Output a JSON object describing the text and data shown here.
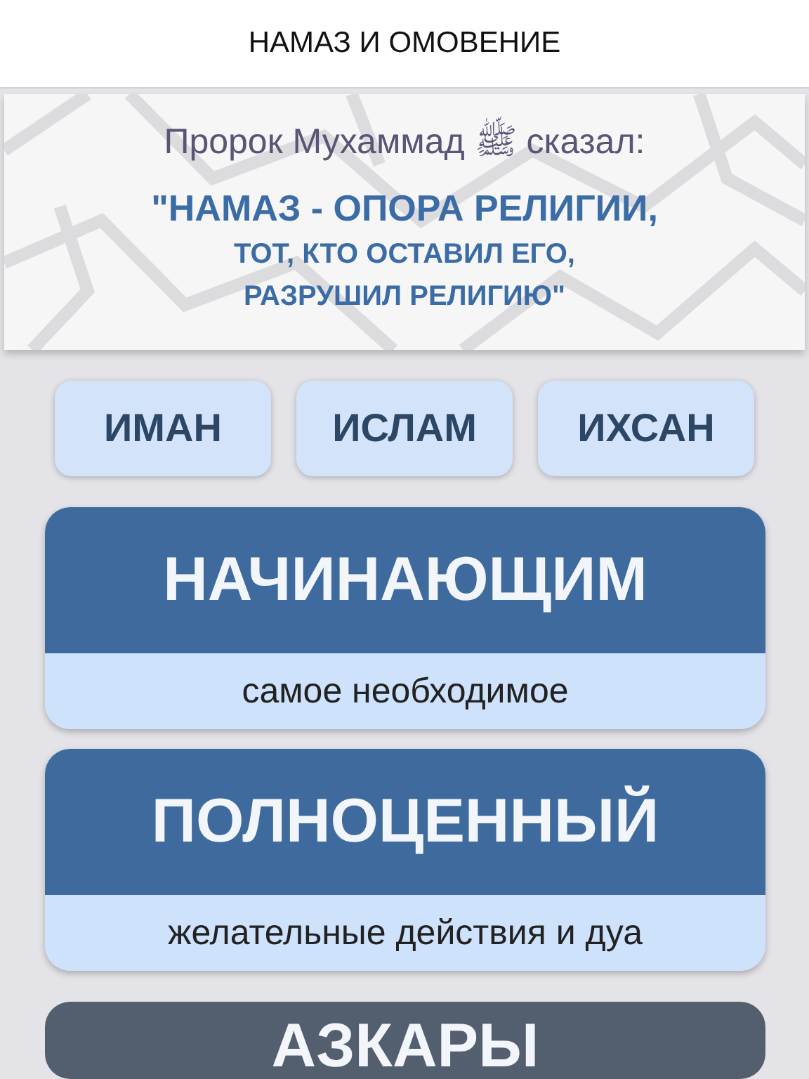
{
  "title": "НАМАЗ И ОМОВЕНИЕ",
  "banner": {
    "attribution": "Пророк Мухаммад ﷺ сказал:",
    "quote_lines": [
      "\"НАМАЗ - ОПОРА РЕЛИГИИ,",
      "ТОТ, КТО ОСТАВИЛ ЕГО,",
      "РАЗРУШИЛ РЕЛИГИЮ\""
    ]
  },
  "topics": [
    "ИМАН",
    "ИСЛАМ",
    "ИХСАН"
  ],
  "sections": [
    {
      "kind": "featured",
      "title": "НАЧИНАЮЩИМ",
      "subtitle": "самое необходимое"
    },
    {
      "kind": "featured",
      "title": "ПОЛНОЦЕННЫЙ",
      "subtitle": "желательные действия и дуа"
    },
    {
      "kind": "plain",
      "title": "АЗКАРЫ"
    }
  ]
}
